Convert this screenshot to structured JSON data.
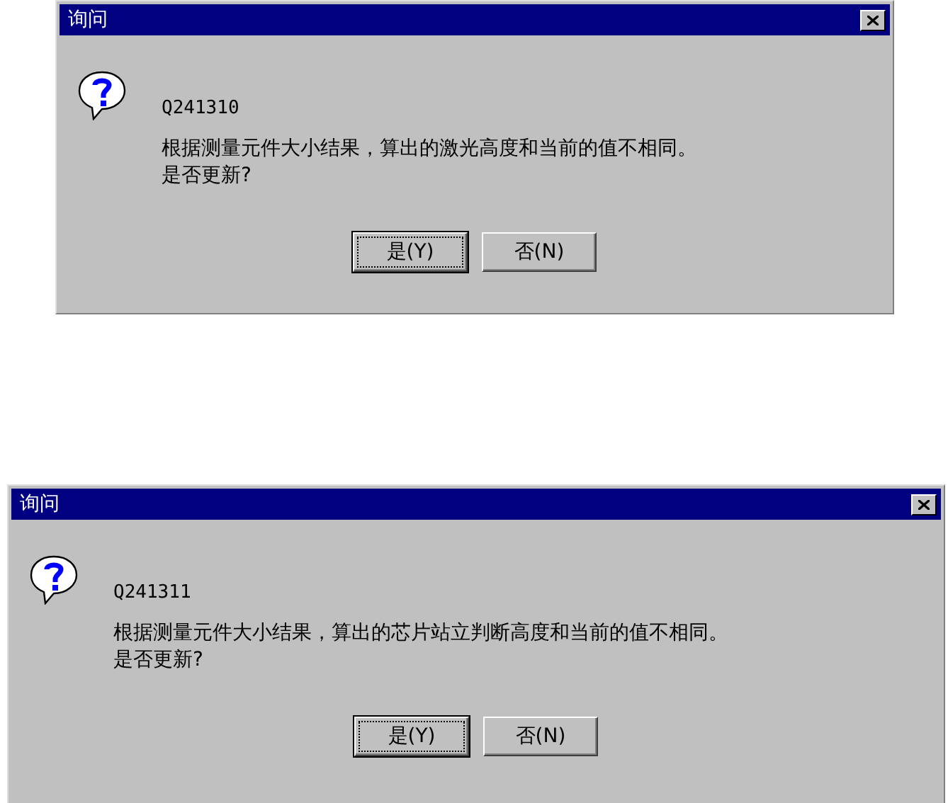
{
  "dialogs": [
    {
      "title": "询问",
      "code": "Q241310",
      "message": [
        "根据测量元件大小结果，算出的激光高度和当前的值不相同。",
        "是否更新?"
      ],
      "buttons": [
        {
          "label": "是(Y)",
          "selected": true
        },
        {
          "label": "否(N)",
          "selected": false
        }
      ]
    },
    {
      "title": "询问",
      "code": "Q241311",
      "message": [
        "根据测量元件大小结果，算出的芯片站立判断高度和当前的值不相同。",
        "是否更新?"
      ],
      "buttons": [
        {
          "label": "是(Y)",
          "selected": true
        },
        {
          "label": "否(N)",
          "selected": false
        }
      ]
    }
  ]
}
